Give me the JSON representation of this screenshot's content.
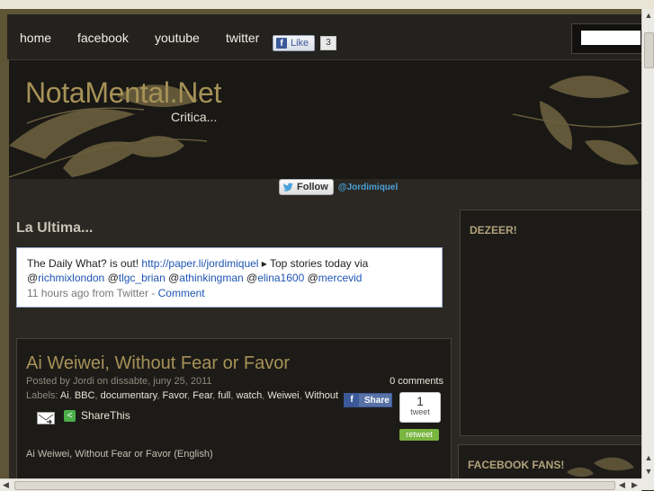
{
  "nav": {
    "items": [
      "home",
      "facebook",
      "youtube",
      "twitter"
    ]
  },
  "fb_like": {
    "label": "Like",
    "count": "3"
  },
  "search": {
    "placeholder": ""
  },
  "header": {
    "title": "NotaMental.Net",
    "tagline": "Critica..."
  },
  "twitter_follow": {
    "button": "Follow",
    "handle": "@Jordimiquel"
  },
  "latest": {
    "title": "La Ultima...",
    "tweet_prefix": "The Daily What? is out! ",
    "tweet_link": "http://paper.li/jordimiquel",
    "tweet_suffix": " ▸ Top stories today via",
    "mentions": [
      "@richmixlondon",
      "@tlgc_brian",
      "@athinkingman",
      "@elina1600",
      "@mercevid"
    ],
    "meta": "11 hours ago from Twitter",
    "separator": " - ",
    "comment_link": "Comment"
  },
  "post": {
    "title": "Ai Weiwei, Without Fear or Favor",
    "meta": "Posted by Jordi on dissabte, juny 25, 2011",
    "comments": "0 comments",
    "labels_label": "Labels: ",
    "labels": [
      "Ai",
      "BBC",
      "documentary",
      "Favor",
      "Fear",
      "full",
      "watch",
      "Weiwei",
      "Without"
    ],
    "share_label": "Share",
    "tweet_count": "1",
    "tweet_word": "tweet",
    "retweet_label": "retweet",
    "sharethis_label": "ShareThis",
    "excerpt": "Ai Weiwei, Without Fear or Favor (English)"
  },
  "sidebar": {
    "dezeer_title": "DEZEER!",
    "fans_title": "FACEBOOK FANS!"
  },
  "colors": {
    "accent_gold": "#a69257",
    "twitter_blue": "#4aa1d8",
    "facebook_blue": "#3b5998",
    "retweet_green": "#79b53f"
  }
}
